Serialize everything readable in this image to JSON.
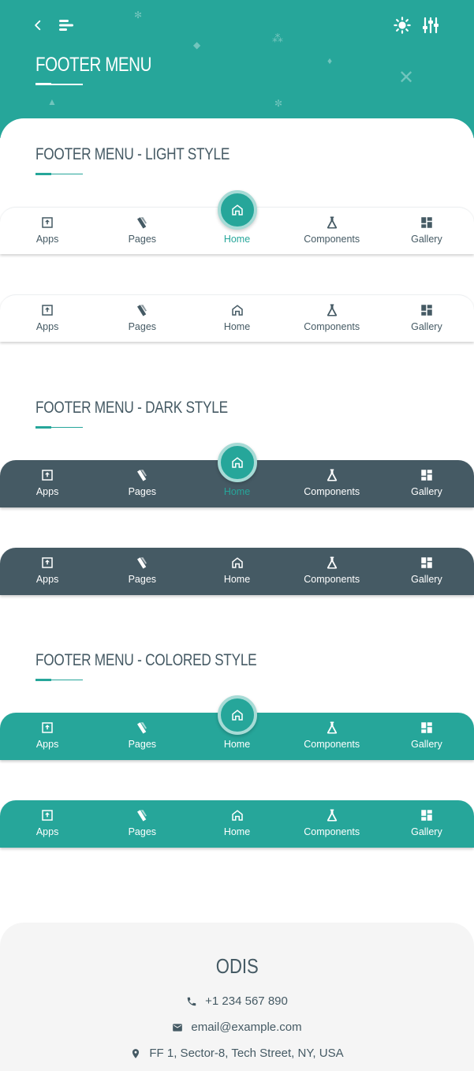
{
  "header": {
    "title": "FOOTER MENU",
    "icons": [
      "back-icon",
      "menu-icon",
      "brightness-icon",
      "settings-sliders-icon"
    ]
  },
  "sections": {
    "light": {
      "title": "FOOTER MENU - LIGHT STYLE"
    },
    "dark": {
      "title": "FOOTER MENU - DARK STYLE"
    },
    "colored": {
      "title": "FOOTER MENU - COLORED STYLE"
    }
  },
  "tabs": {
    "apps": "Apps",
    "pages": "Pages",
    "home": "Home",
    "components": "Components",
    "gallery": "Gallery"
  },
  "footer": {
    "brand": "ODIS",
    "phone": "+1 234 567 890",
    "email": "email@example.com",
    "address": "FF 1, Sector-8, Tech Street, NY, USA"
  },
  "colors": {
    "accent": "#26a69a",
    "dark": "#455a64",
    "footer_bg": "#f5f5f5"
  }
}
